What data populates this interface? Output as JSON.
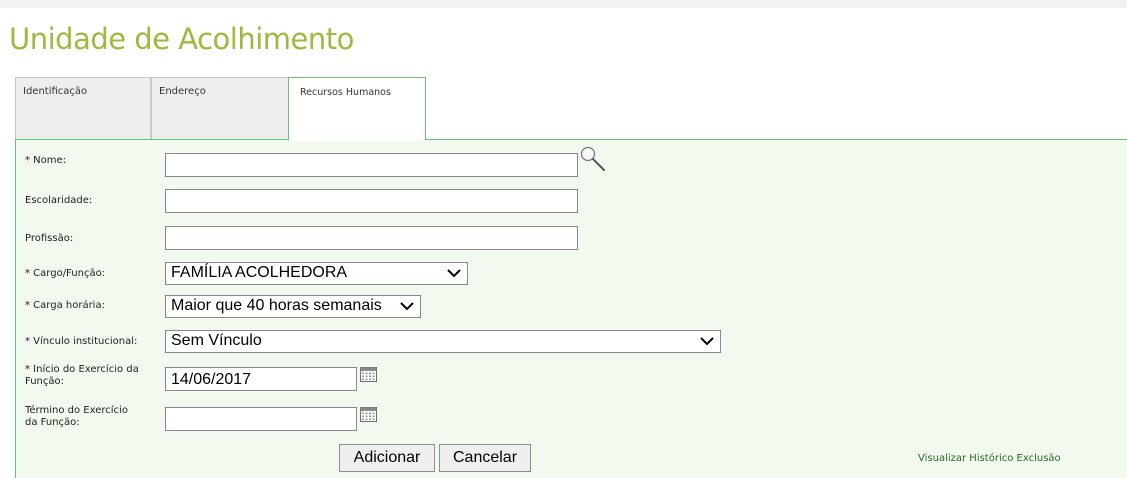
{
  "page": {
    "title": "Unidade de Acolhimento"
  },
  "tabs": [
    {
      "label": "Identificação"
    },
    {
      "label": "Endereço"
    },
    {
      "label": "Recursos Humanos"
    }
  ],
  "form": {
    "nome": {
      "label": "* Nome:",
      "value": ""
    },
    "escolaridade": {
      "label": "Escolaridade:",
      "value": ""
    },
    "profissao": {
      "label": "Profissão:",
      "value": ""
    },
    "cargo": {
      "label": "* Cargo/Função:",
      "selected": "FAMÍLIA ACOLHEDORA"
    },
    "carga": {
      "label": "* Carga horária:",
      "selected": "Maior que 40 horas semanais"
    },
    "vinculo": {
      "label": "* Vínculo institucional:",
      "selected": "Sem Vínculo"
    },
    "inicio": {
      "label_line1": "* Início do Exercício da",
      "label_line2": "Função:",
      "value": "14/06/2017"
    },
    "termino": {
      "label_line1": "Término do Exercício",
      "label_line2": "da Função:",
      "value": ""
    }
  },
  "buttons": {
    "add": "Adicionar",
    "cancel": "Cancelar"
  },
  "links": {
    "history": "Visualizar Histórico Exclusão"
  },
  "icons": {
    "search": "magnifier-icon",
    "calendar": "calendar-icon",
    "dropdown": "chevron-down-icon"
  },
  "colors": {
    "title": "#9dba3f",
    "panel_bg": "#f2faf0",
    "panel_border": "#6ec16e",
    "link": "#2b6a24"
  }
}
